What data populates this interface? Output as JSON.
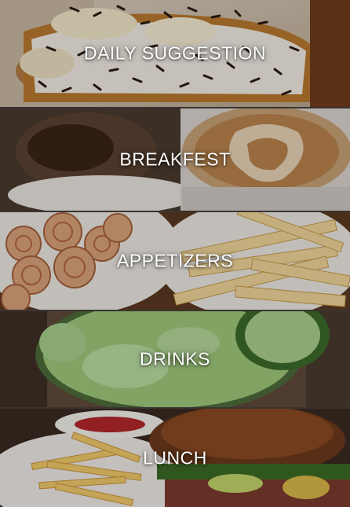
{
  "menu": {
    "categories": [
      {
        "label": "DAILY SUGGESTION",
        "photo": "toast-with-chocolate-sprinkles"
      },
      {
        "label": "BREAKFEST",
        "photo": "latte-art-and-pastry"
      },
      {
        "label": "APPETIZERS",
        "photo": "pinwheels-and-bread-sticks"
      },
      {
        "label": "DRINKS",
        "photo": "cucumber-smoothie"
      },
      {
        "label": "LUNCH",
        "photo": "burger-and-fries"
      }
    ]
  },
  "colors": {
    "label_text": "#ffffff",
    "background": "#1e1a17"
  }
}
